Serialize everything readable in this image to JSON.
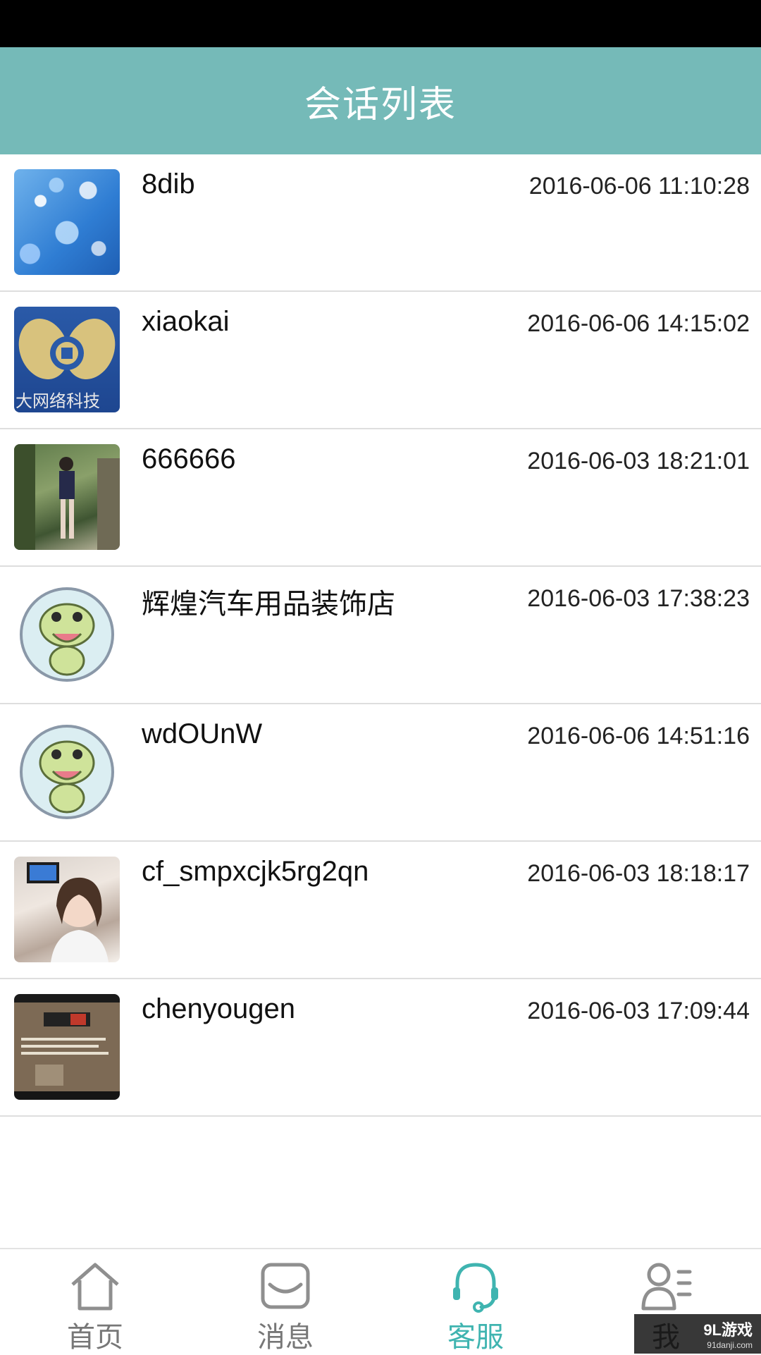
{
  "header": {
    "title": "会话列表"
  },
  "conversations": [
    {
      "name": "8dib",
      "time": "2016-06-06 11:10:28",
      "avatar": "bokeh-photo"
    },
    {
      "name": "xiaokai",
      "time": "2016-06-06 14:15:02",
      "avatar": "company-logo",
      "avatar_text": "大网络科技"
    },
    {
      "name": "666666",
      "time": "2016-06-03 18:21:01",
      "avatar": "photo"
    },
    {
      "name": "辉煌汽车用品装饰店",
      "time": "2016-06-03 17:38:23",
      "avatar": "dinosaur-default"
    },
    {
      "name": "wdOUnW",
      "time": "2016-06-06 14:51:16",
      "avatar": "dinosaur-default"
    },
    {
      "name": "cf_smpxcjk5rg2qn",
      "time": "2016-06-03 18:18:17",
      "avatar": "photo"
    },
    {
      "name": "chenyougen",
      "time": "2016-06-03 17:09:44",
      "avatar": "photo"
    }
  ],
  "tabbar": {
    "tabs": [
      {
        "label": "首页",
        "icon": "home-icon"
      },
      {
        "label": "消息",
        "icon": "message-icon"
      },
      {
        "label": "客服",
        "icon": "headset-icon",
        "active": true
      },
      {
        "label": "我",
        "icon": "profile-icon"
      }
    ]
  },
  "watermark": {
    "main": "9L游戏",
    "sub": "91danji.com"
  },
  "colors": {
    "header": "#75bab8",
    "active_tab": "#3fb4b0"
  }
}
